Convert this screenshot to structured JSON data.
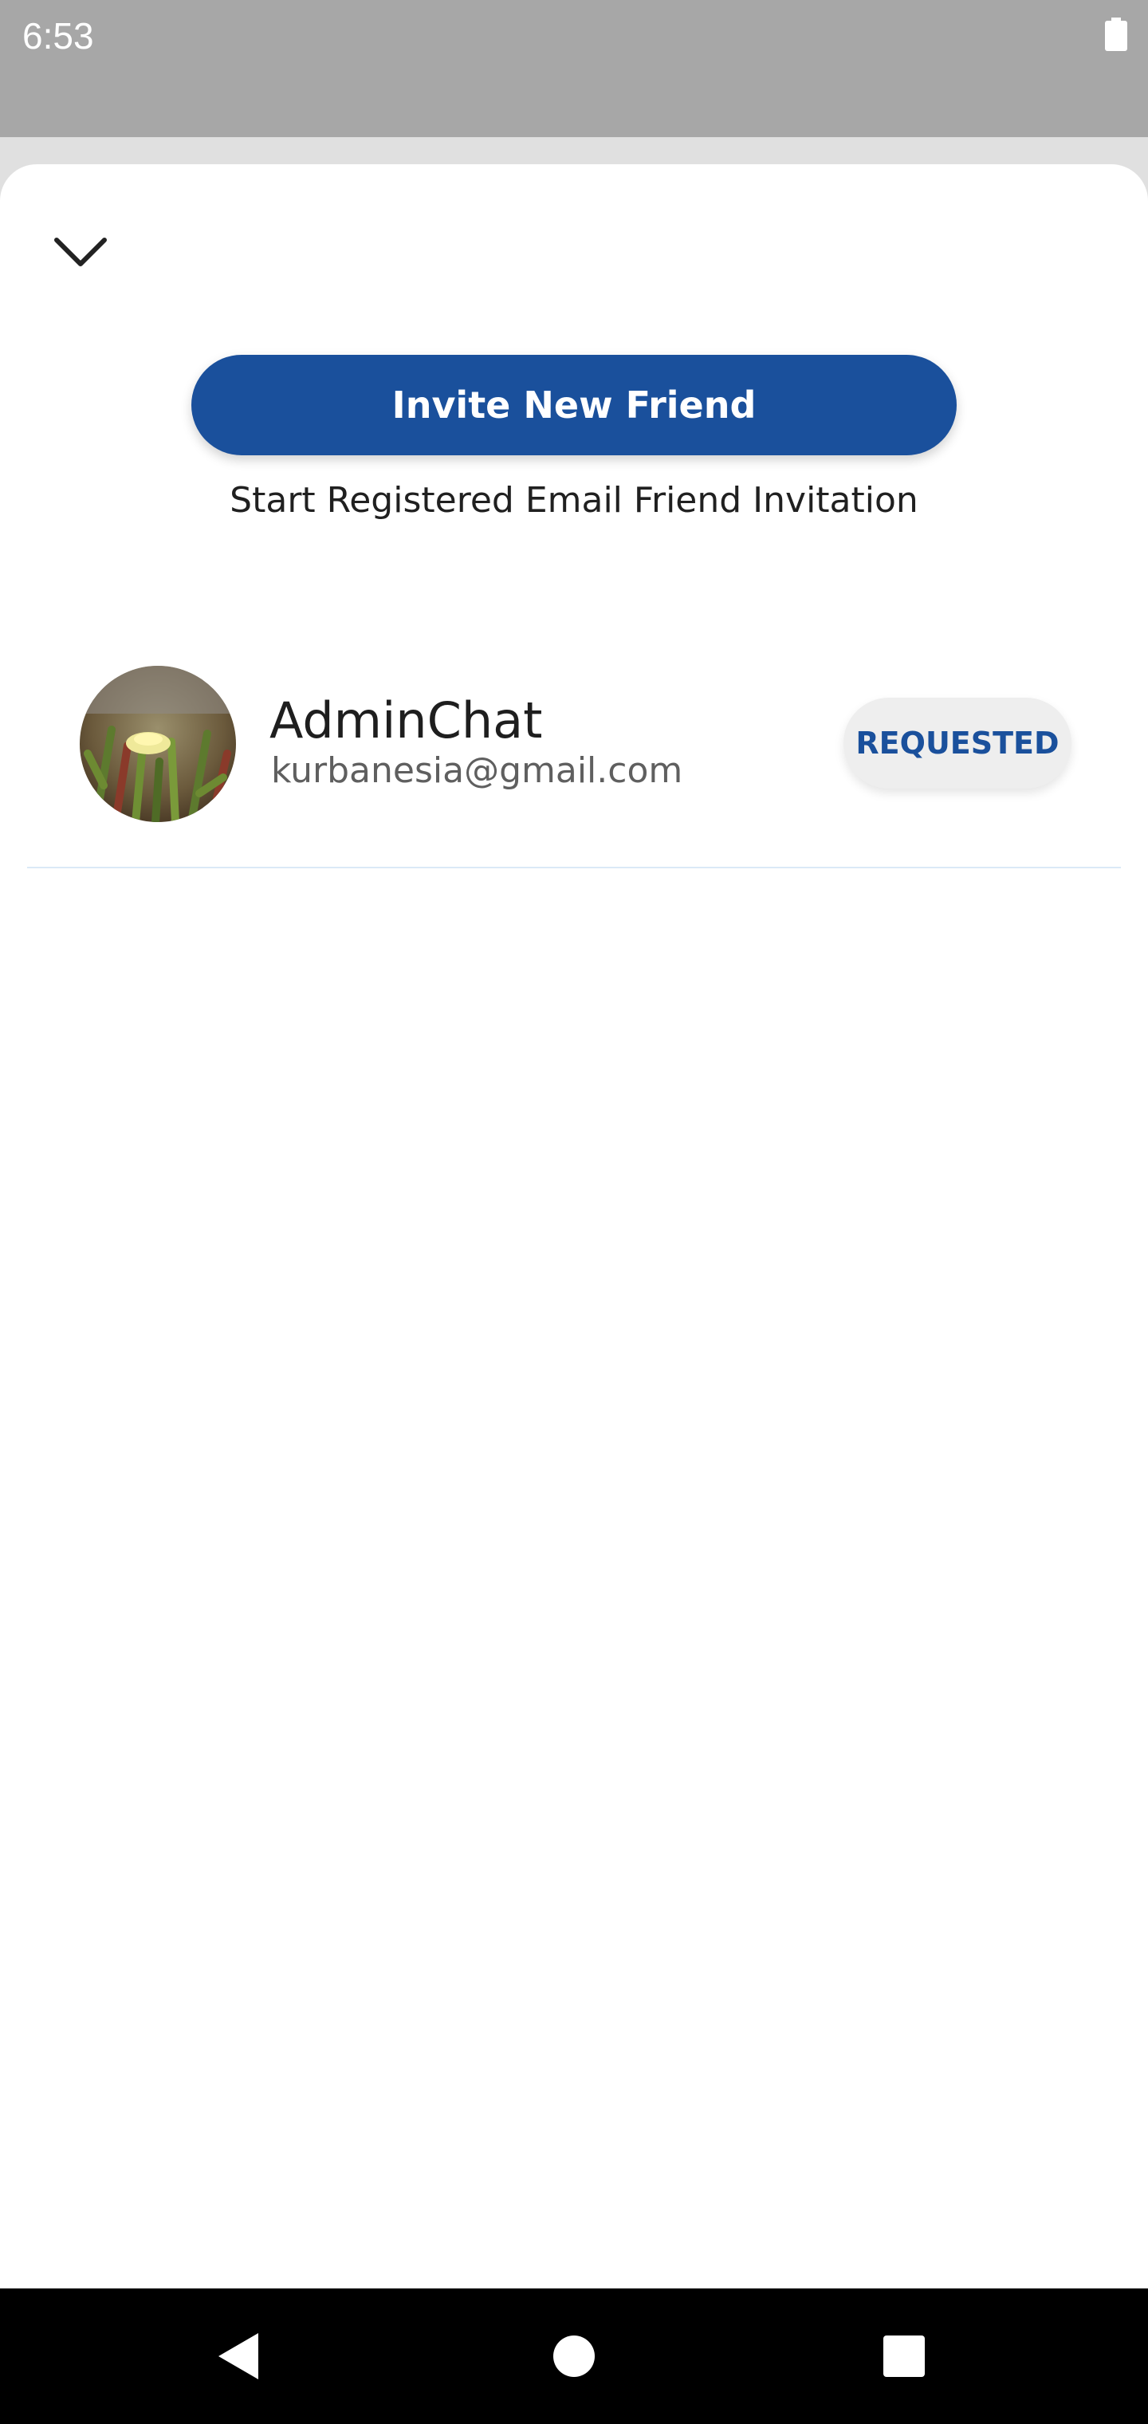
{
  "status_bar": {
    "time": "6:53",
    "battery_icon": "battery-full-icon"
  },
  "sheet": {
    "collapse_icon": "chevron-down-icon",
    "invite_button_label": "Invite New Friend",
    "invite_subtitle": "Start Registered Email Friend Invitation",
    "accent_color": "#1a509c"
  },
  "friends": [
    {
      "name": "AdminChat",
      "email": "kurbanesia@gmail.com",
      "status_label": "REQUESTED",
      "avatar": "flower-photo"
    }
  ],
  "nav_bar": {
    "back_icon": "back-triangle-icon",
    "home_icon": "home-circle-icon",
    "recents_icon": "recents-square-icon"
  }
}
